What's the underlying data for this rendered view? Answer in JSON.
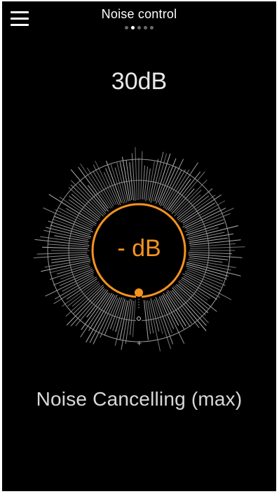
{
  "header": {
    "title": "Noise control",
    "page_count": 5,
    "active_page": 2
  },
  "level": {
    "value": "30dB"
  },
  "dial": {
    "center_value": "- dB",
    "plus_symbol": "+",
    "accent_color": "#f7931e"
  },
  "mode": {
    "label": "Noise Cancelling (max)"
  },
  "icons": {
    "menu": "hamburger-menu-icon"
  }
}
